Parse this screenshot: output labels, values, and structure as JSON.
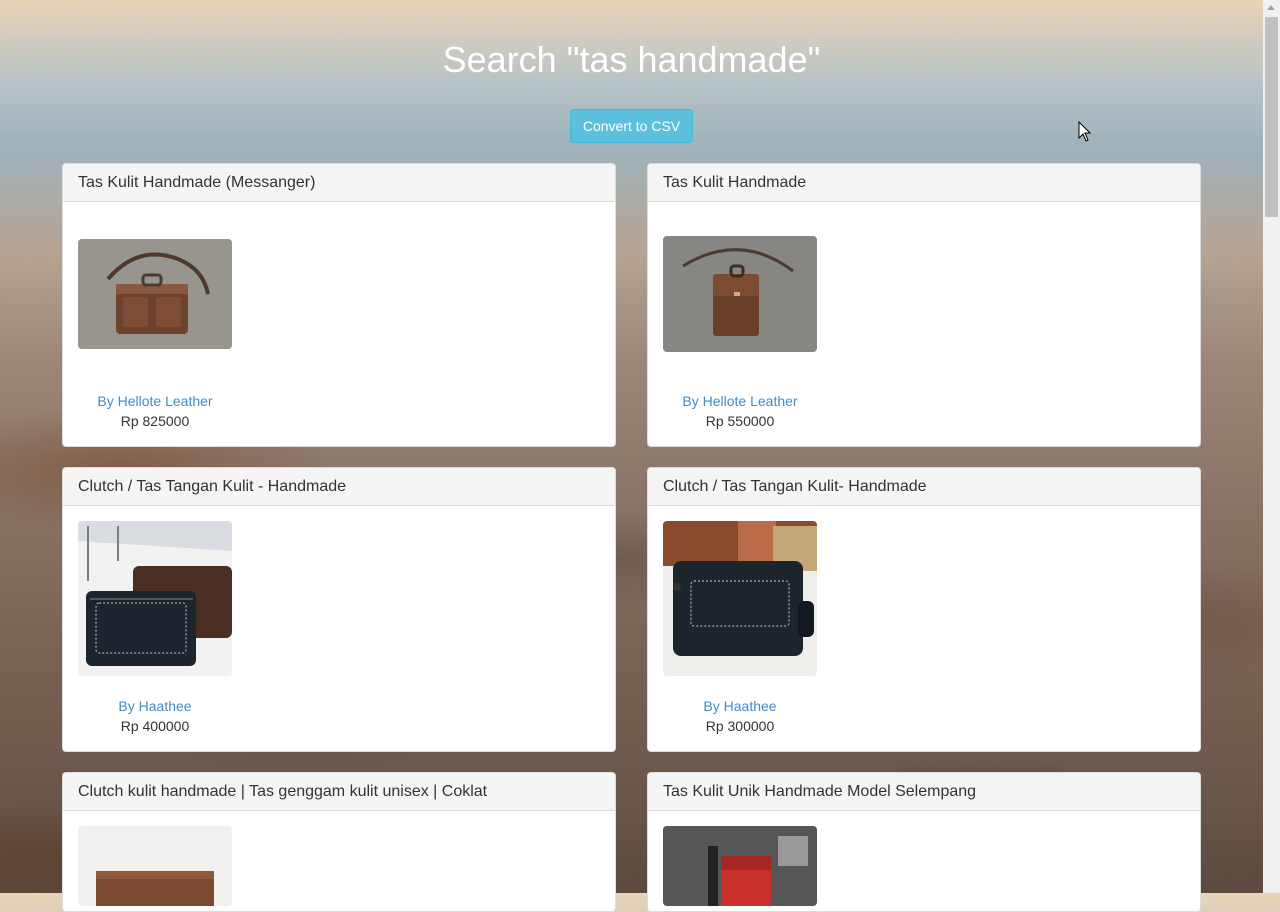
{
  "page": {
    "title": "Search \"tas handmade\"",
    "convert_button": "Convert to CSV"
  },
  "products": [
    {
      "title": "Tas Kulit Handmade (Messanger)",
      "seller": "By Hellote Leather",
      "price": "Rp 825000"
    },
    {
      "title": "Tas Kulit Handmade",
      "seller": "By Hellote Leather",
      "price": "Rp 550000"
    },
    {
      "title": "Clutch / Tas Tangan Kulit - Handmade",
      "seller": "By Haathee",
      "price": "Rp 400000"
    },
    {
      "title": "Clutch / Tas Tangan Kulit- Handmade",
      "seller": "By Haathee",
      "price": "Rp 300000"
    },
    {
      "title": "Clutch kulit handmade | Tas genggam kulit unisex | Coklat"
    },
    {
      "title": "Tas Kulit Unik Handmade Model Selempang"
    }
  ],
  "colors": {
    "accent_button": "#5bc0de",
    "link": "#428bca"
  }
}
